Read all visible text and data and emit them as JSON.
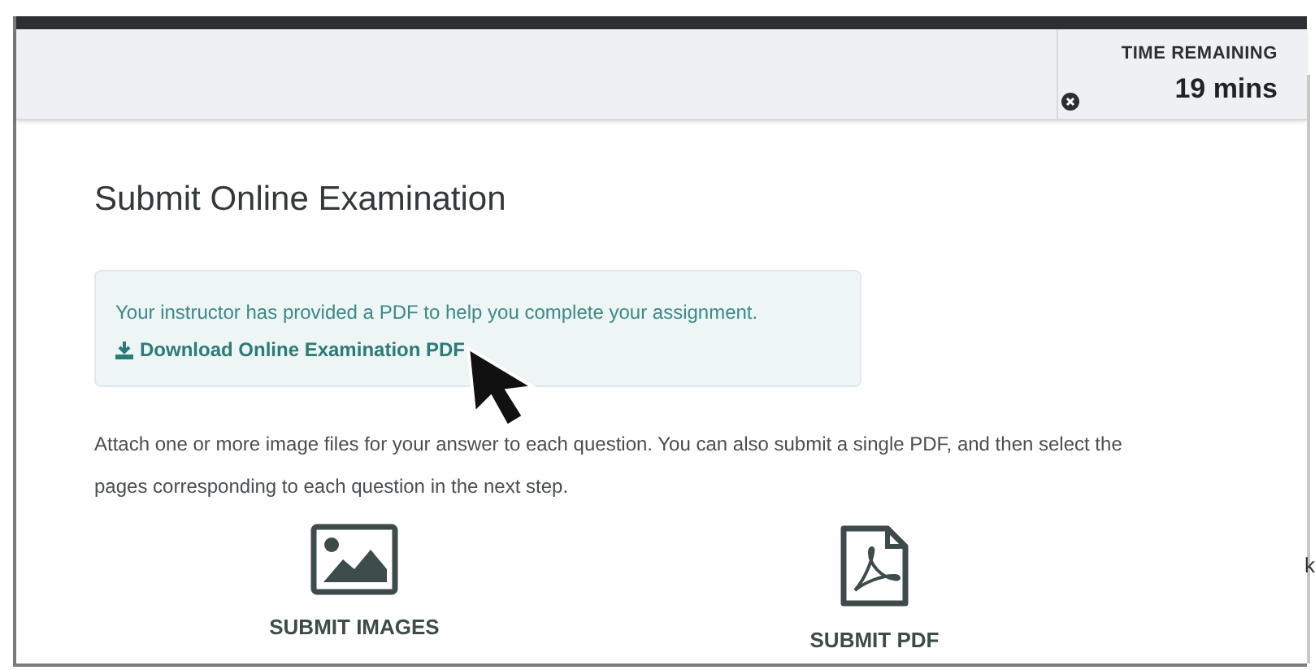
{
  "timer": {
    "label": "TIME REMAINING",
    "value": "19 mins"
  },
  "title": "Submit Online Examination",
  "notice": {
    "text": "Your instructor has provided a PDF to help you complete your assignment.",
    "link": "Download Online Examination PDF"
  },
  "instructions": "Attach one or more image files for your answer to each question. You can also submit a single PDF, and then select the pages corresponding to each question in the next step.",
  "options": [
    {
      "kind": "images",
      "label": "SUBMIT IMAGES"
    },
    {
      "kind": "pdf",
      "label": "SUBMIT PDF"
    }
  ],
  "edge_text": "k"
}
